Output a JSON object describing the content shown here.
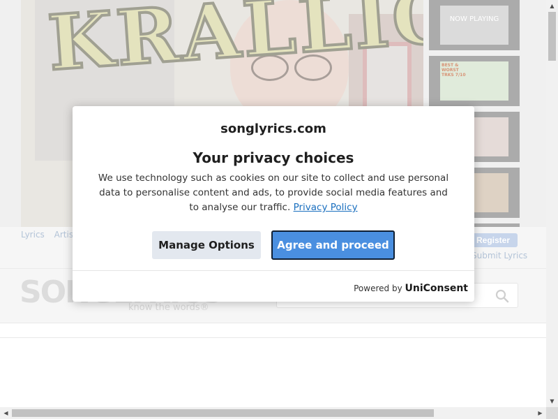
{
  "video": {
    "title_text": "KRALLICE",
    "playlist": [
      {
        "label": "NOW PLAYING"
      },
      {
        "label": "BEST & WORST TRKS 7/10"
      },
      {
        "label": ""
      },
      {
        "label": ""
      }
    ]
  },
  "nav": {
    "links": [
      "Lyrics",
      "Artist"
    ],
    "register": "Register",
    "submit_lyrics": "Submit Lyrics"
  },
  "header": {
    "logo": "SONGLYRICS",
    "tagline": "know the words®"
  },
  "consent": {
    "site": "songlyrics.com",
    "title": "Your privacy choices",
    "body": "We use technology such as cookies on our site to collect and use personal data to personalise content and ads, to provide social media features and to analyse our traffic.",
    "privacy_link": "Privacy Policy",
    "manage_button": "Manage Options",
    "agree_button": "Agree and proceed",
    "powered_by_prefix": "Powered by",
    "powered_by_brand": "UniConsent"
  },
  "icons": {
    "search": "search-icon",
    "scroll_up": "arrow-up-icon",
    "scroll_down": "arrow-down-icon",
    "scroll_left": "arrow-left-icon",
    "scroll_right": "arrow-right-icon"
  },
  "colors": {
    "accent": "#4a8fe0",
    "link": "#1a6fbf",
    "secondary_button": "#e3e8ef"
  }
}
